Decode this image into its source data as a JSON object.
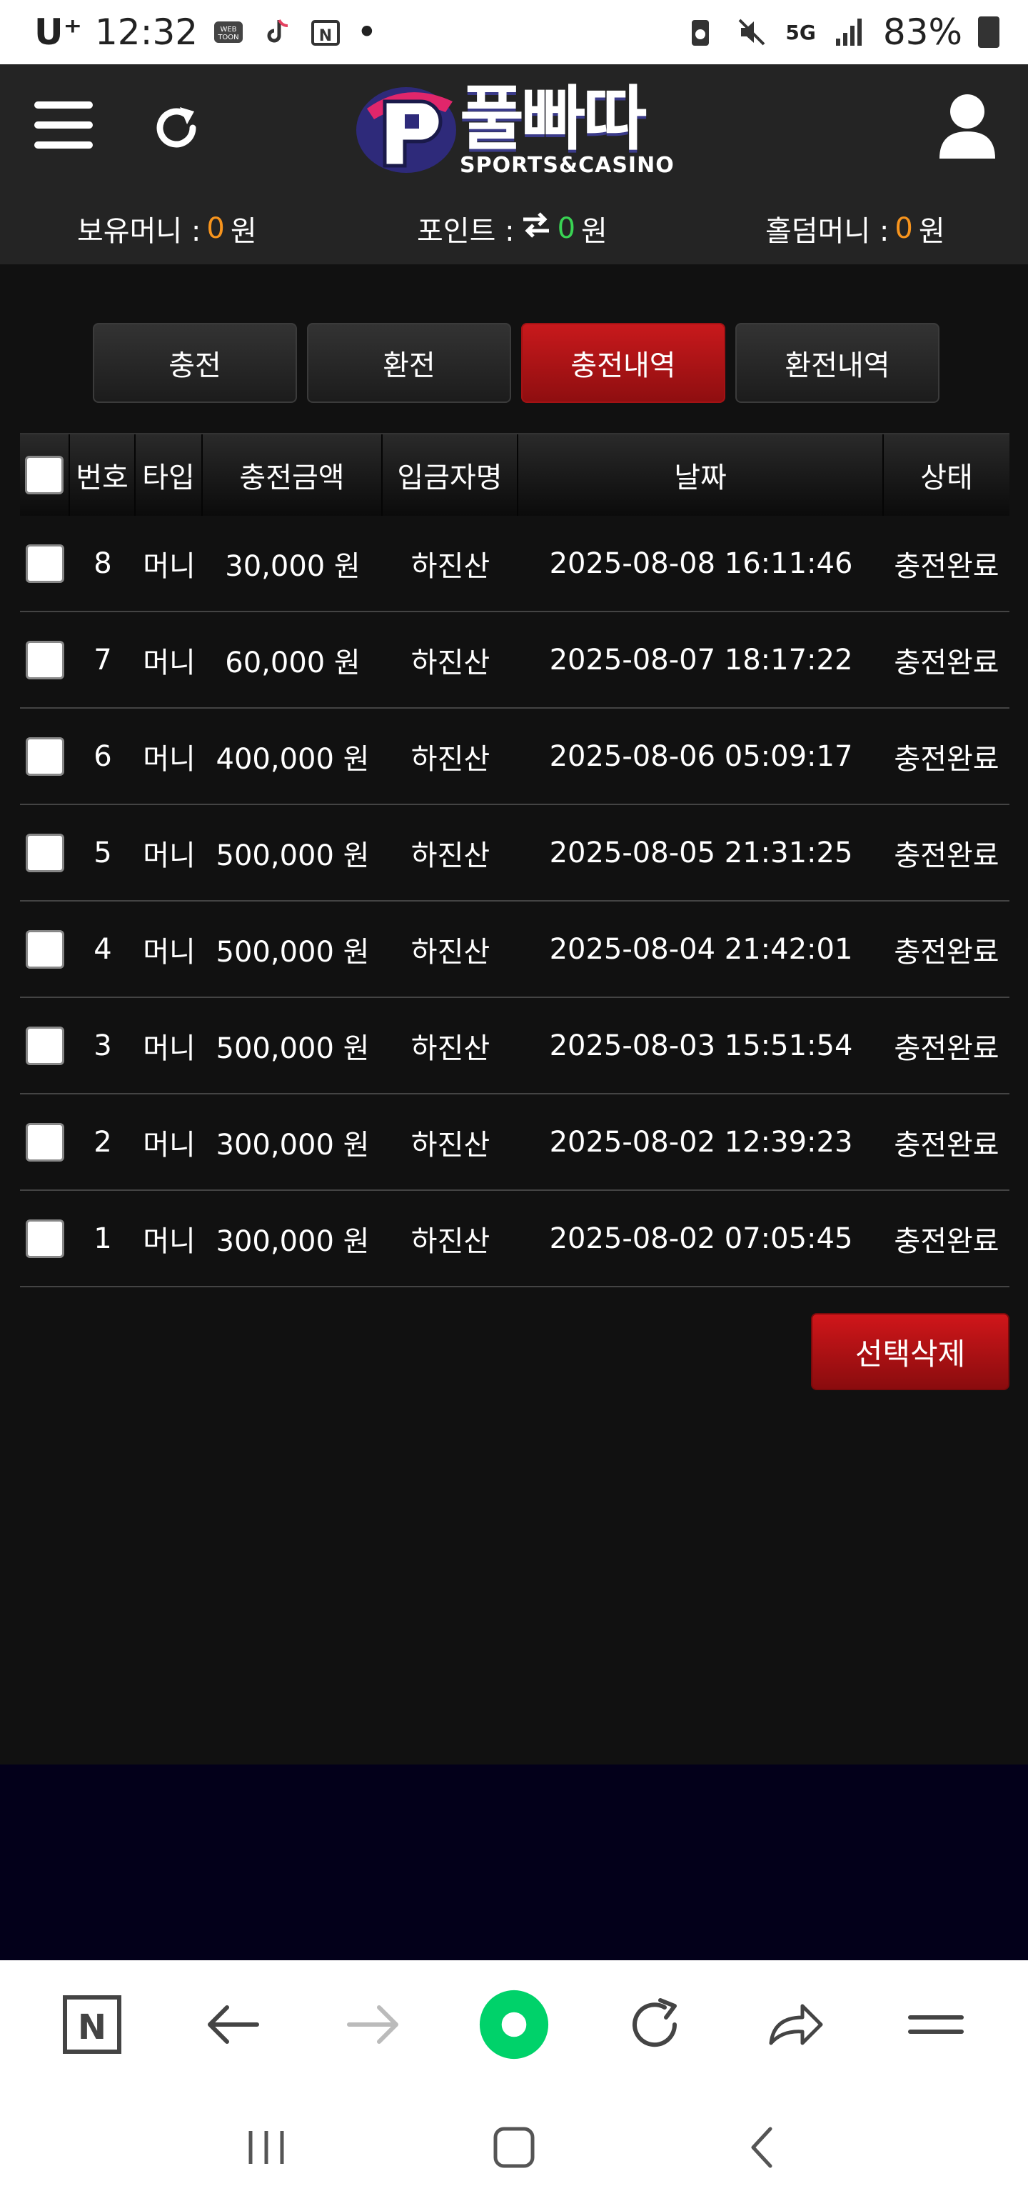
{
  "status_bar": {
    "carrier": "U⁺",
    "time": "12:32",
    "network": "5G",
    "battery_percent": "83%",
    "dot": "•"
  },
  "header": {
    "logo_text": "풀빠따",
    "logo_sub": "SPORTS&CASINO",
    "balances": [
      {
        "label": "보유머니 :",
        "value": "0",
        "unit": "원"
      },
      {
        "label": "포인트 :",
        "value": "0",
        "unit": "원"
      },
      {
        "label": "홀덤머니 :",
        "value": "0",
        "unit": "원"
      }
    ]
  },
  "tabs": [
    {
      "label": "충전",
      "active": false
    },
    {
      "label": "환전",
      "active": false
    },
    {
      "label": "충전내역",
      "active": true
    },
    {
      "label": "환전내역",
      "active": false
    }
  ],
  "table": {
    "headers": [
      "번호",
      "타입",
      "충전금액",
      "입금자명",
      "날짜",
      "상태"
    ],
    "rows": [
      {
        "no": "8",
        "type": "머니",
        "amount": "30,000 원",
        "name": "하진산",
        "date": "2025-08-08 16:11:46",
        "status": "충전완료"
      },
      {
        "no": "7",
        "type": "머니",
        "amount": "60,000 원",
        "name": "하진산",
        "date": "2025-08-07 18:17:22",
        "status": "충전완료"
      },
      {
        "no": "6",
        "type": "머니",
        "amount": "400,000 원",
        "name": "하진산",
        "date": "2025-08-06 05:09:17",
        "status": "충전완료"
      },
      {
        "no": "5",
        "type": "머니",
        "amount": "500,000 원",
        "name": "하진산",
        "date": "2025-08-05 21:31:25",
        "status": "충전완료"
      },
      {
        "no": "4",
        "type": "머니",
        "amount": "500,000 원",
        "name": "하진산",
        "date": "2025-08-04 21:42:01",
        "status": "충전완료"
      },
      {
        "no": "3",
        "type": "머니",
        "amount": "500,000 원",
        "name": "하진산",
        "date": "2025-08-03 15:51:54",
        "status": "충전완료"
      },
      {
        "no": "2",
        "type": "머니",
        "amount": "300,000 원",
        "name": "하진산",
        "date": "2025-08-02 12:39:23",
        "status": "충전완료"
      },
      {
        "no": "1",
        "type": "머니",
        "amount": "300,000 원",
        "name": "하진산",
        "date": "2025-08-02 07:05:45",
        "status": "충전완료"
      }
    ]
  },
  "delete_button": "선택삭제",
  "colors": {
    "accent_red": "#b81417",
    "money_orange": "#f7941d",
    "point_green": "#39d353",
    "page_bg": "#111111",
    "header_bg": "#242424",
    "browser_accent": "#00d26a"
  }
}
